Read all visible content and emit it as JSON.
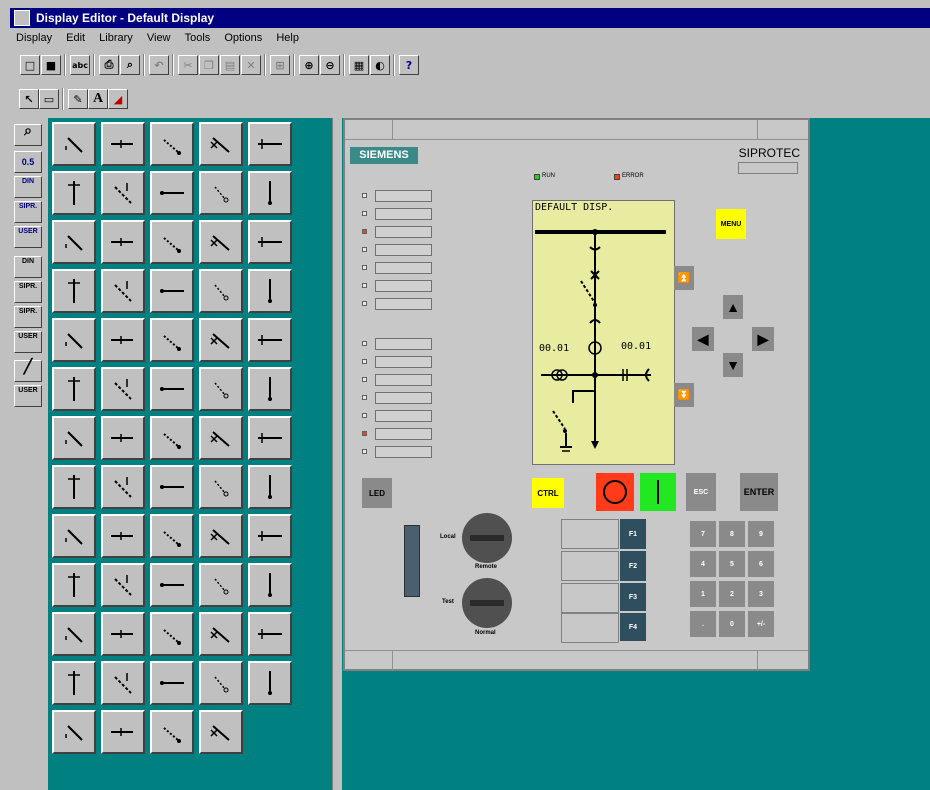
{
  "window": {
    "title": "Display Editor - Default Display"
  },
  "menu": [
    "Display",
    "Edit",
    "Library",
    "View",
    "Tools",
    "Options",
    "Help"
  ],
  "toolbar": {
    "icons": [
      "new-icon",
      "save-icon",
      "spell-icon",
      "print-icon",
      "preview-icon",
      "undo-icon",
      "cut-icon",
      "copy-icon",
      "paste-icon",
      "delete-icon",
      "format-icon",
      "zoom-in-icon",
      "zoom-out-icon",
      "grid-icon",
      "contrast-icon",
      "help-icon"
    ]
  },
  "tools": {
    "select": "select-icon",
    "rect": "rect-icon",
    "pen": "pen-icon",
    "text_label": "A",
    "eraser": "eraser-icon"
  },
  "sidebar": {
    "items": [
      "0.5",
      "DIN",
      "SIPR.",
      "USER",
      "DIN",
      "SIPR.",
      "SIPR.",
      "USER",
      "",
      "USER"
    ]
  },
  "device": {
    "brand": "SIEMENS",
    "model": "SIPROTEC",
    "run": "RUN",
    "error": "ERROR",
    "lcd_title": "DEFAULT DISP.",
    "value_left": "00.01",
    "value_right": "00.01",
    "menu": "MENU",
    "led": "LED",
    "ctrl": "CTRL",
    "esc": "ESC",
    "enter": "ENTER",
    "local": "Local",
    "remote": "Remote",
    "test": "Test",
    "normal": "Normal",
    "fkeys": [
      "F1",
      "F2",
      "F3",
      "F4"
    ],
    "numpad": [
      "7",
      "8",
      "9",
      "4",
      "5",
      "6",
      "1",
      "2",
      "3",
      ".",
      "0",
      "+/-"
    ]
  },
  "colors": {
    "titlebar": "#000080",
    "teal": "#008080",
    "lcd": "#e8eca0",
    "menu_key": "#ffff00",
    "off_red": "#ff3b1a",
    "on_green": "#22e822"
  }
}
